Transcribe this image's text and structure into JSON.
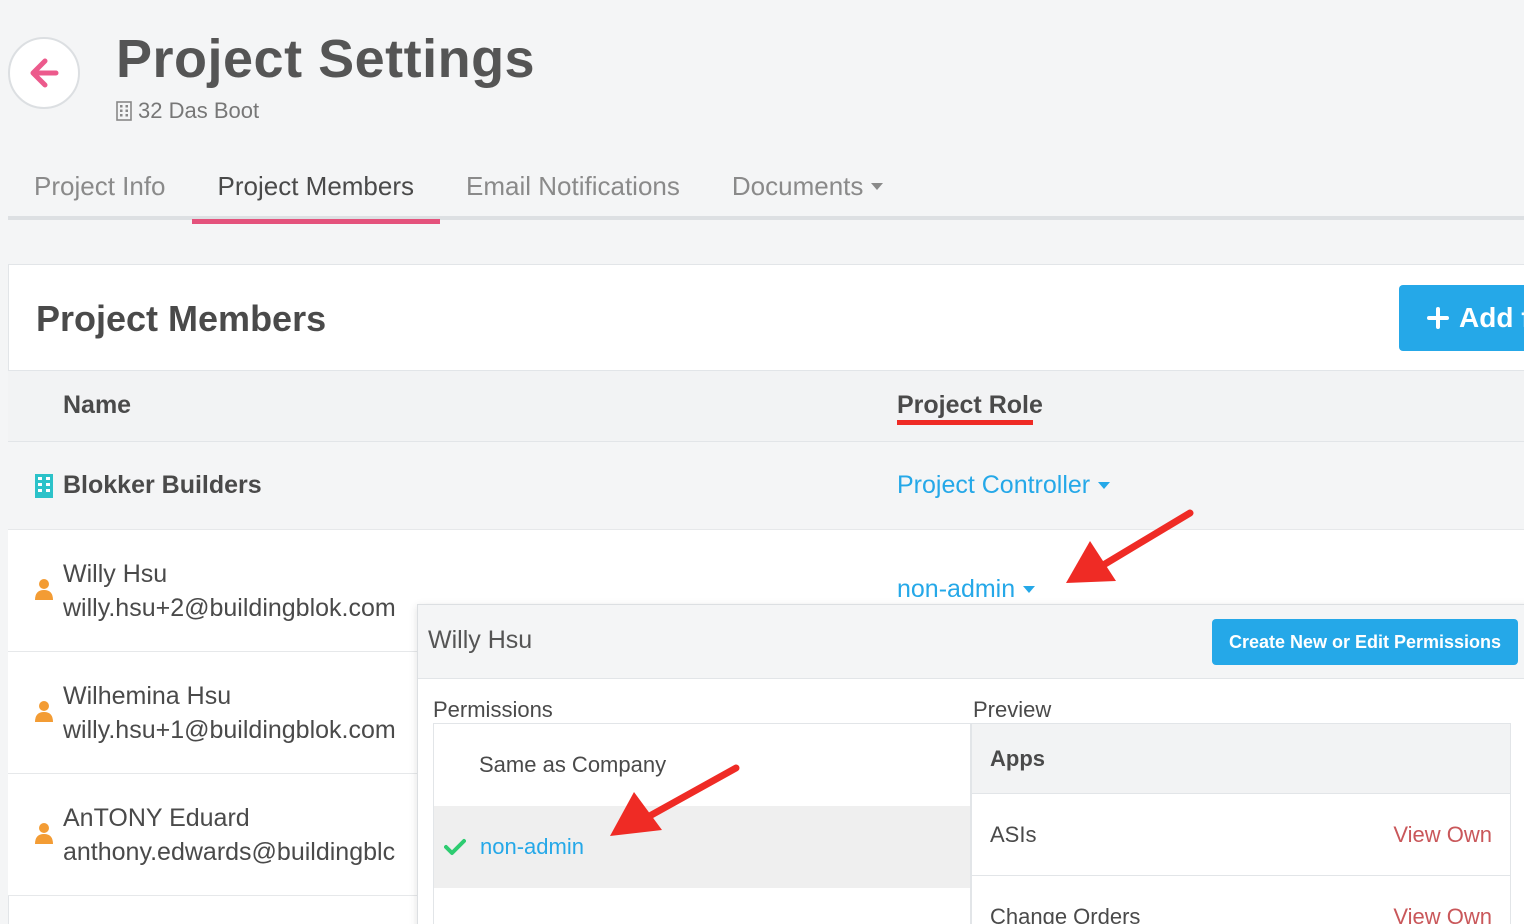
{
  "header": {
    "title": "Project Settings",
    "subtitle": "32 Das Boot"
  },
  "tabs": [
    {
      "label": "Project Info",
      "active": false
    },
    {
      "label": "Project Members",
      "active": true
    },
    {
      "label": "Email Notifications",
      "active": false
    },
    {
      "label": "Documents",
      "active": false
    }
  ],
  "members_card": {
    "title": "Project Members",
    "add_button_label": "Add f",
    "columns": {
      "name": "Name",
      "role": "Project Role"
    },
    "company_row": {
      "name": "Blokker Builders",
      "role": "Project Controller"
    },
    "members": [
      {
        "name": "Willy Hsu",
        "email": "willy.hsu+2@buildingblok.com",
        "role": "non-admin"
      },
      {
        "name": "Wilhemina Hsu",
        "email": "willy.hsu+1@buildingblok.com"
      },
      {
        "name": "AnTONY Eduard",
        "email": "anthony.edwards@buildingblc"
      }
    ]
  },
  "popover": {
    "member_name": "Willy Hsu",
    "edit_button_label": "Create New or Edit Permissions",
    "permissions_label": "Permissions",
    "preview_label": "Preview",
    "permission_options": [
      {
        "label": "Same as Company",
        "selected": false
      },
      {
        "label": "non-admin",
        "selected": true
      }
    ],
    "preview": {
      "header": "Apps",
      "rows": [
        {
          "app": "ASIs",
          "access": "View Own"
        },
        {
          "app": "Change Orders",
          "access": "View Own"
        }
      ]
    }
  },
  "colors": {
    "accent_blue": "#25a8e8",
    "tab_active_pink": "#e4527c",
    "back_arrow_pink": "#ec5a8c",
    "annotation_red": "#ef2b25",
    "company_icon_teal": "#2bc2c9",
    "user_icon_orange": "#f39c34",
    "check_green": "#2ecc71",
    "access_red": "#c9575a"
  }
}
